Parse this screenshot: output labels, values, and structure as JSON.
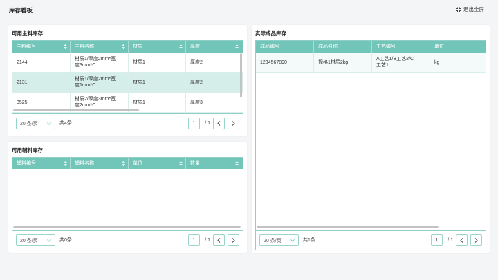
{
  "header": {
    "title": "库存看板",
    "exit_label": "退出全屏",
    "exit_icon": "exit-fullscreen-icon"
  },
  "colors": {
    "accent": "#72c5b9",
    "border": "#8fcfc5",
    "selected_row": "#d5eeea",
    "scrollbar": "#c3c3c3"
  },
  "icons": {
    "sort": "sort-icon",
    "dropdown": "chevron-down-icon",
    "prev": "chevron-left-icon",
    "next": "chevron-right-icon"
  },
  "cards": {
    "main": {
      "title": "可用主料库存",
      "sortable": true,
      "columns": [
        "主料编号",
        "主料名称",
        "材质",
        "厚度"
      ],
      "rows": [
        [
          "2144",
          "材质1/厚度2mm*宽度3mm*C",
          "材质1",
          "厚度2"
        ],
        [
          "2131",
          "材质1/厚度2mm*宽度1mm*C",
          "材质1",
          "厚度2"
        ],
        [
          "3525",
          "材质2/厚度3mm*宽度2mm*C",
          "材质1",
          "厚度3"
        ]
      ],
      "selected_row": 1,
      "pager": {
        "page_size": "20 条/页",
        "total": "共4条",
        "page": "1",
        "of": "/ 1"
      }
    },
    "aux": {
      "title": "可用辅料库存",
      "sortable": true,
      "columns": [
        "辅料编号",
        "辅料名称",
        "单位",
        "数量"
      ],
      "rows": [],
      "selected_row": null,
      "pager": {
        "page_size": "20 条/页",
        "total": "共0条",
        "page": "1",
        "of": "/ 1"
      }
    },
    "product": {
      "title": "实际成品库存",
      "sortable": false,
      "columns": [
        "成品编号",
        "成品名称",
        "工艺编号",
        "单位"
      ],
      "rows": [
        [
          "1234567890",
          "规格1材质2kg",
          "A工艺1/B工艺2/C工艺1",
          "kg"
        ]
      ],
      "selected_row": null,
      "pager": {
        "page_size": "20 条/页",
        "total": "共1条",
        "page": "1",
        "of": "/ 1"
      }
    }
  }
}
